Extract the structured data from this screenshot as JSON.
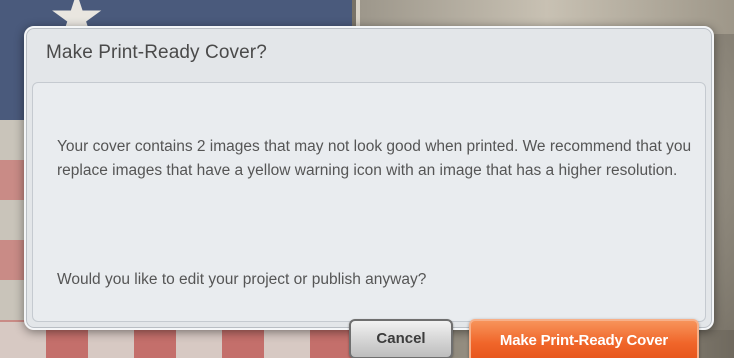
{
  "dialog": {
    "title": "Make Print-Ready Cover?",
    "message": "Your cover contains 2 images that may not look good when printed. We recommend that you replace images that have a yellow warning icon with an image that has a higher resolution.",
    "question": "Would you like to edit your project or publish anyway?",
    "cancel_label": "Cancel",
    "primary_label": "Make Print-Ready Cover"
  },
  "colors": {
    "primary_button": "#f0662a",
    "cancel_button": "#d4d4d4",
    "dialog_bg": "#e3e6e9"
  }
}
